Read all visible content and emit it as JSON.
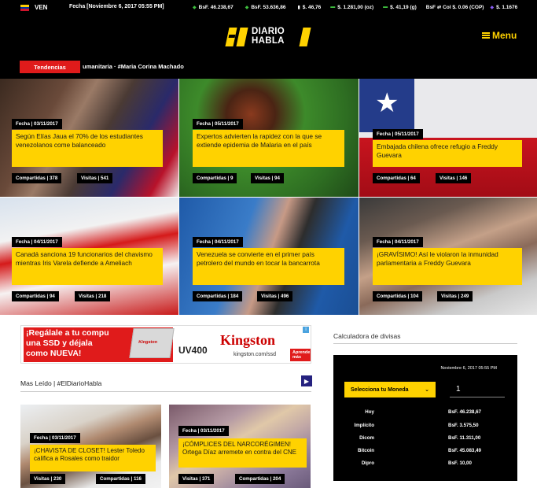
{
  "ticker": {
    "country": "VEN",
    "date": "Fecha [Noviembre 6, 2017 05:55 PM]",
    "rates": [
      {
        "text": "BsF. 46.238,67"
      },
      {
        "text": "BsF. 53.636,86"
      },
      {
        "text": "$. 46,76"
      },
      {
        "text": "$. 1.281,00 (oz)"
      },
      {
        "text": "$. 41,19 (g)"
      },
      {
        "text": "BsF ⇄ Col $. 0.06 (COP)"
      },
      {
        "text": "$. 1.1676"
      }
    ]
  },
  "header": {
    "logo_line1": "DIARIO",
    "logo_line2": "HABLA",
    "menu_label": "Menu",
    "trending_button": "Tendencias",
    "trending_text": "umanitaria  ·  #Maria Corina Machado"
  },
  "cards": [
    {
      "date": "Fecha | 03/11/2017",
      "title": "Según Elías Jaua el 70% de los estudiantes venezolanos come balanceado",
      "shares": "Compartidas | 378",
      "views": "Visitas | 541"
    },
    {
      "date": "Fecha | 05/11/2017",
      "title": "Expertos advierten la rapidez con la que se extiende epidemia de Malaria en el país",
      "shares": "Compartidas | 9",
      "views": "Visitas | 94"
    },
    {
      "date": "Fecha | 05/11/2017",
      "title": "Embajada chilena ofrece refugio a Freddy Guevara",
      "shares": "Compartidas | 64",
      "views": "Visitas | 146"
    },
    {
      "date": "Fecha | 04/11/2017",
      "title": "Canadá sanciona 19 funcionarios del chavismo mientras Iris Varela defiende a Ameliach",
      "shares": "Compartidas | 94",
      "views": "Visitas | 218"
    },
    {
      "date": "Fecha | 04/11/2017",
      "title": "Venezuela se convierte en el primer país petrolero del mundo en tocar la bancarrota",
      "shares": "Compartidas | 184",
      "views": "Visitas | 496"
    },
    {
      "date": "Fecha | 04/11/2017",
      "title": "¡GRAVÍSIMO! Así le violaron la inmunidad parlamentaria a Freddy Guevara",
      "shares": "Compartidas | 104",
      "views": "Visitas | 249"
    }
  ],
  "ad": {
    "line1": "¡Regálale a tu compu",
    "line2": "una SSD y déjala",
    "line3": "como NUEVA!",
    "product": "UV400",
    "brand": "Kingston",
    "url": "kingston.com/ssd",
    "cta": "Aprende más"
  },
  "more": {
    "label": "Mas Leído | #ElDiarioHabla",
    "items": [
      {
        "date": "Fecha | 03/11/2017",
        "title": "¡CHAVISTA DE CLOSET! Lester Toledo califica a Rosales como traidor",
        "views": "Visitas | 230",
        "shares": "Compartidas | 116"
      },
      {
        "date": "Fecha | 03/11/2017",
        "title": "¡CÓMPLICES DEL NARCORÉGIMEN! Ortega Díaz arremete en contra del CNE",
        "views": "Visitas | 371",
        "shares": "Compartidas | 204"
      }
    ]
  },
  "calculator": {
    "title": "Calculadora de divisas",
    "date": "Noviembre 6, 2017 05:55 PM",
    "select_label": "Selecciona tu Moneda",
    "amount": "1",
    "rows": [
      {
        "label": "Hoy",
        "value": "BsF. 46.238,67"
      },
      {
        "label": "Implícito",
        "value": "BsF. 3.575,50"
      },
      {
        "label": "Dicom",
        "value": "BsF. 11.311,00"
      },
      {
        "label": "Bitcoin",
        "value": "BsF. 45.083,49"
      },
      {
        "label": "Dipro",
        "value": "BsF. 10,00"
      }
    ]
  },
  "colors": {
    "accent": "#ffd200",
    "trending": "#e01b1b",
    "nav_button": "#25217f"
  }
}
